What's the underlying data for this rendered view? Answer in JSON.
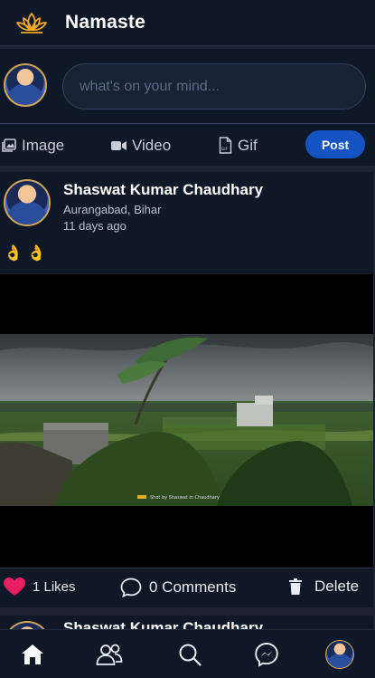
{
  "header": {
    "title": "Namaste",
    "logo_icon": "lotus-icon",
    "logo_color": "#f5a623"
  },
  "composer": {
    "placeholder": "what's on your mind...",
    "actions": [
      {
        "label": "Image",
        "icon": "image-icon"
      },
      {
        "label": "Video",
        "icon": "video-icon"
      },
      {
        "label": "Gif",
        "icon": "gif-icon"
      }
    ],
    "post_label": "Post",
    "post_color": "#1553c2"
  },
  "posts": [
    {
      "author": "Shaswat Kumar Chaudhary",
      "location": "Aurangabad, Bihar",
      "time_ago": "11 days ago",
      "text": "👌 👌",
      "image_caption": "Shot by Shaswat in Chaudhary",
      "likes": "1 Likes",
      "comments": "0 Comments",
      "delete_label": "Delete",
      "like_color": "#e91e63"
    },
    {
      "author": "Shaswat Kumar Chaudhary"
    }
  ],
  "bottom_nav": {
    "items": [
      "home-icon",
      "friends-icon",
      "search-icon",
      "messenger-icon",
      "profile-avatar"
    ]
  }
}
